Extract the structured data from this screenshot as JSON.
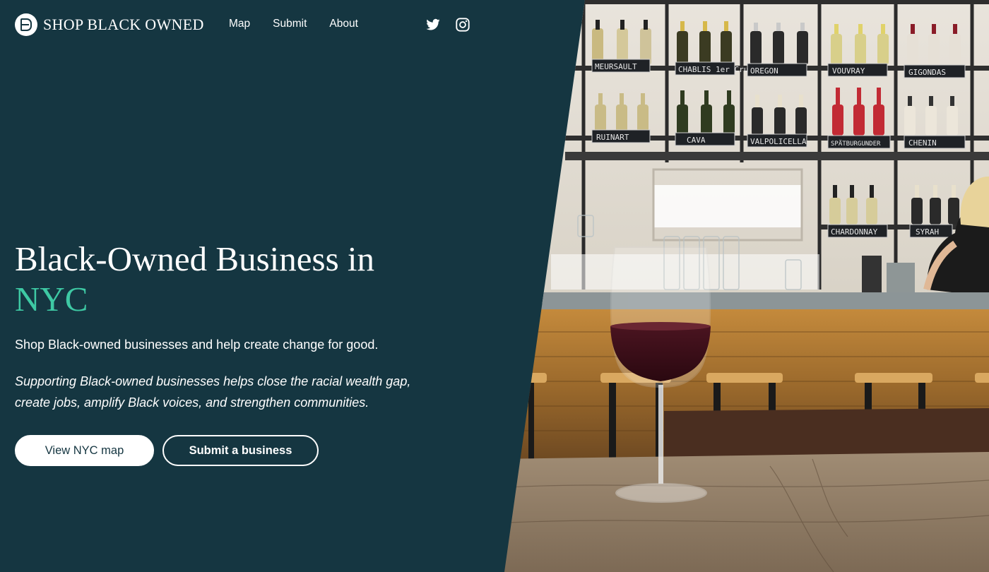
{
  "brand": {
    "name": "Shop Black Owned",
    "logo_icon": "b-monogram-icon"
  },
  "nav": {
    "items": [
      {
        "label": "Map"
      },
      {
        "label": "Submit"
      },
      {
        "label": "About"
      }
    ]
  },
  "social": [
    {
      "icon": "twitter-icon"
    },
    {
      "icon": "instagram-icon"
    }
  ],
  "hero": {
    "title": "Black-Owned Business in",
    "city": "NYC",
    "lead": "Shop Black-owned businesses and help create change for good.",
    "sub": "Supporting Black-owned businesses helps close the racial wealth gap, create jobs, amplify Black voices, and strengthen communities.",
    "primary_button": "View NYC map",
    "secondary_button": "Submit a business"
  },
  "photo": {
    "description": "wine-bar-photo",
    "shelf_labels": [
      "MEURSAULT",
      "CHABLIS 1er Cru",
      "OREGON",
      "VOUVRAY",
      "GIGONDAS",
      "RUINART",
      "CAVA",
      "VALPOLICELLA",
      "SPÄTBURGUNDER",
      "CHENIN",
      "CHARDONNAY",
      "SYRAH"
    ]
  },
  "colors": {
    "background": "#153641",
    "accent": "#3ec9a4",
    "text": "#ffffff"
  }
}
